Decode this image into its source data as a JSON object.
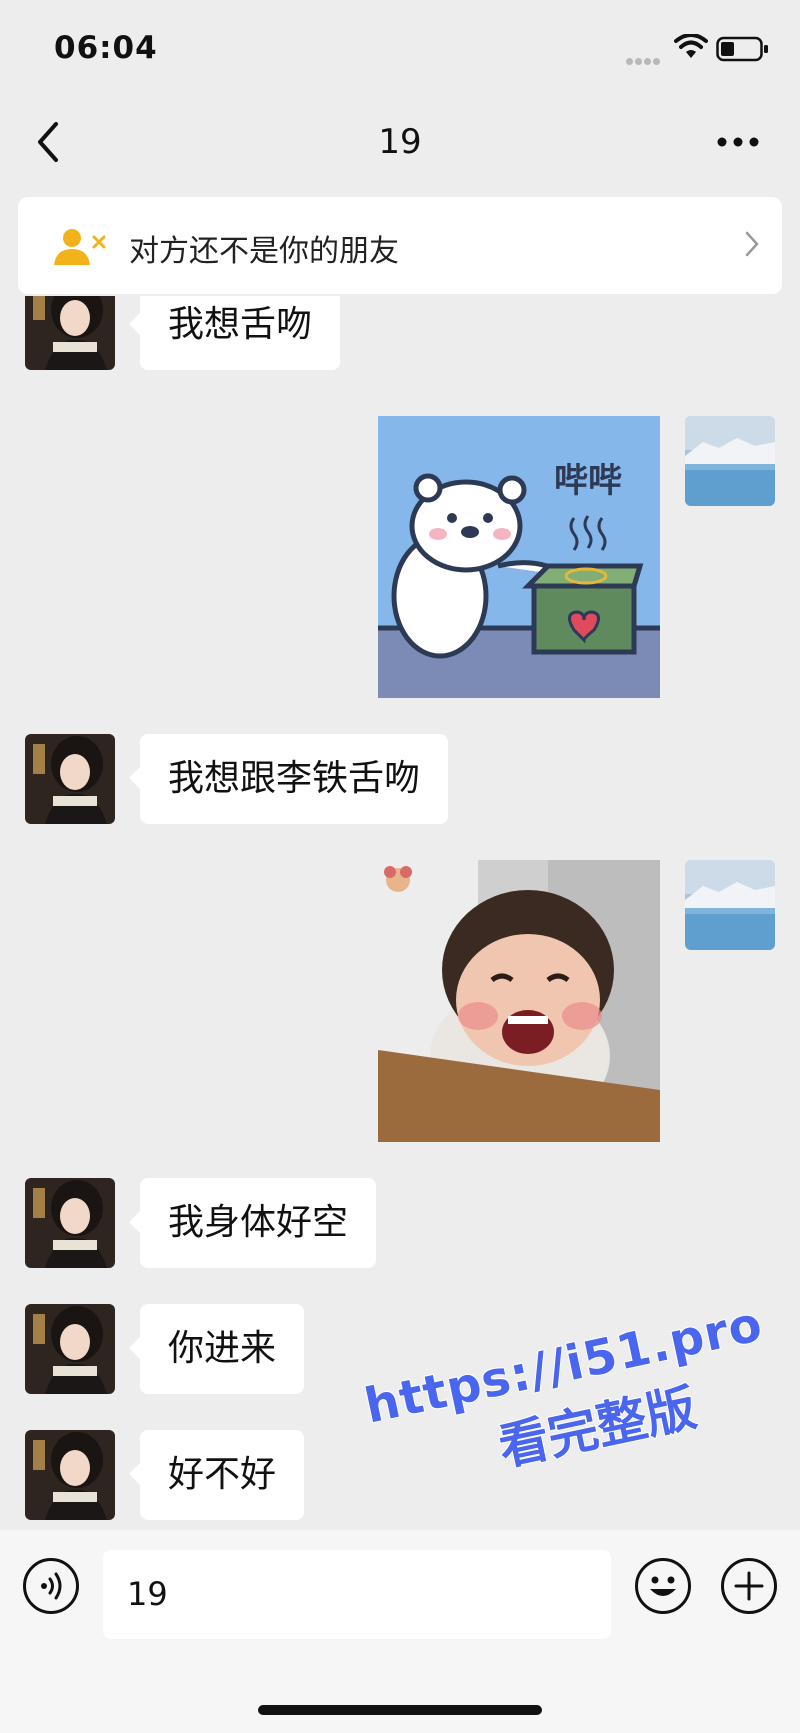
{
  "status_bar": {
    "time": "06:04"
  },
  "nav": {
    "title": "19"
  },
  "banner": {
    "text": "对方还不是你的朋友"
  },
  "messages": [
    {
      "side": "left",
      "type": "text",
      "text": "我想舌吻"
    },
    {
      "side": "right",
      "type": "sticker",
      "sticker_caption": "哔哔"
    },
    {
      "side": "left",
      "type": "text",
      "text": "我想跟李铁舌吻"
    },
    {
      "side": "right",
      "type": "sticker",
      "sticker_caption": ""
    },
    {
      "side": "left",
      "type": "text",
      "text": "我身体好空"
    },
    {
      "side": "left",
      "type": "text",
      "text": "你进来"
    },
    {
      "side": "left",
      "type": "text",
      "text": "好不好"
    }
  ],
  "input": {
    "value": "19"
  },
  "watermark": {
    "url": "https://i51.pro",
    "sub": "看完整版"
  },
  "colors": {
    "background": "#ededed",
    "bubble": "#ffffff",
    "banner_icon": "#f2b21c",
    "watermark": "#4a66ee"
  },
  "icons": [
    "back-icon",
    "more-icon",
    "user-x-icon",
    "chevron-right-icon",
    "voice-icon",
    "emoji-icon",
    "plus-icon",
    "wifi-icon",
    "battery-icon"
  ]
}
